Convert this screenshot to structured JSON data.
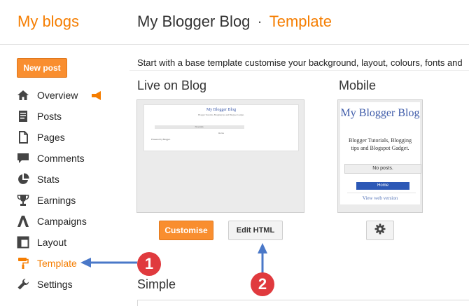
{
  "header": {
    "brand": "My blogs",
    "blog_name": "My Blogger Blog",
    "separator": "·",
    "section": "Template"
  },
  "sidebar": {
    "new_post": "New post",
    "items": [
      {
        "label": "Overview",
        "icon": "home-icon"
      },
      {
        "label": "Posts",
        "icon": "posts-icon"
      },
      {
        "label": "Pages",
        "icon": "pages-icon"
      },
      {
        "label": "Comments",
        "icon": "comment-icon"
      },
      {
        "label": "Stats",
        "icon": "pie-chart-icon"
      },
      {
        "label": "Earnings",
        "icon": "trophy-icon"
      },
      {
        "label": "Campaigns",
        "icon": "campaigns-icon"
      },
      {
        "label": "Layout",
        "icon": "layout-icon"
      },
      {
        "label": "Template",
        "icon": "paint-roller-icon",
        "active": true
      },
      {
        "label": "Settings",
        "icon": "wrench-icon"
      }
    ]
  },
  "main": {
    "intro": "Start with a base template customise your background, layout, colours, fonts and",
    "live_heading": "Live on Blog",
    "mobile_heading": "Mobile",
    "live_preview": {
      "title": "My Blogger Blog",
      "tagline": "Blogger Tutorials, Blogging tips and Blogspot Gadget.",
      "bar_text": "No posts.",
      "home": "Home",
      "powered": "Powered by Blogger."
    },
    "mobile_preview": {
      "title": "My Blogger Blog",
      "description": "Blogger Tutorials, Blogging tips and Blogspot Gadget.",
      "no_posts": "No posts.",
      "home": "Home",
      "web_version": "View web version"
    },
    "customise_label": "Customise",
    "edit_html_label": "Edit HTML",
    "simple_heading": "Simple"
  },
  "annotations": {
    "callout_1": "1",
    "callout_2": "2"
  },
  "colors": {
    "accent": "#f57d00",
    "button_orange": "#f98e2f",
    "callout_red": "#e03a3e",
    "arrow_blue": "#4a78c8",
    "link_blue": "#3d5aa8"
  }
}
